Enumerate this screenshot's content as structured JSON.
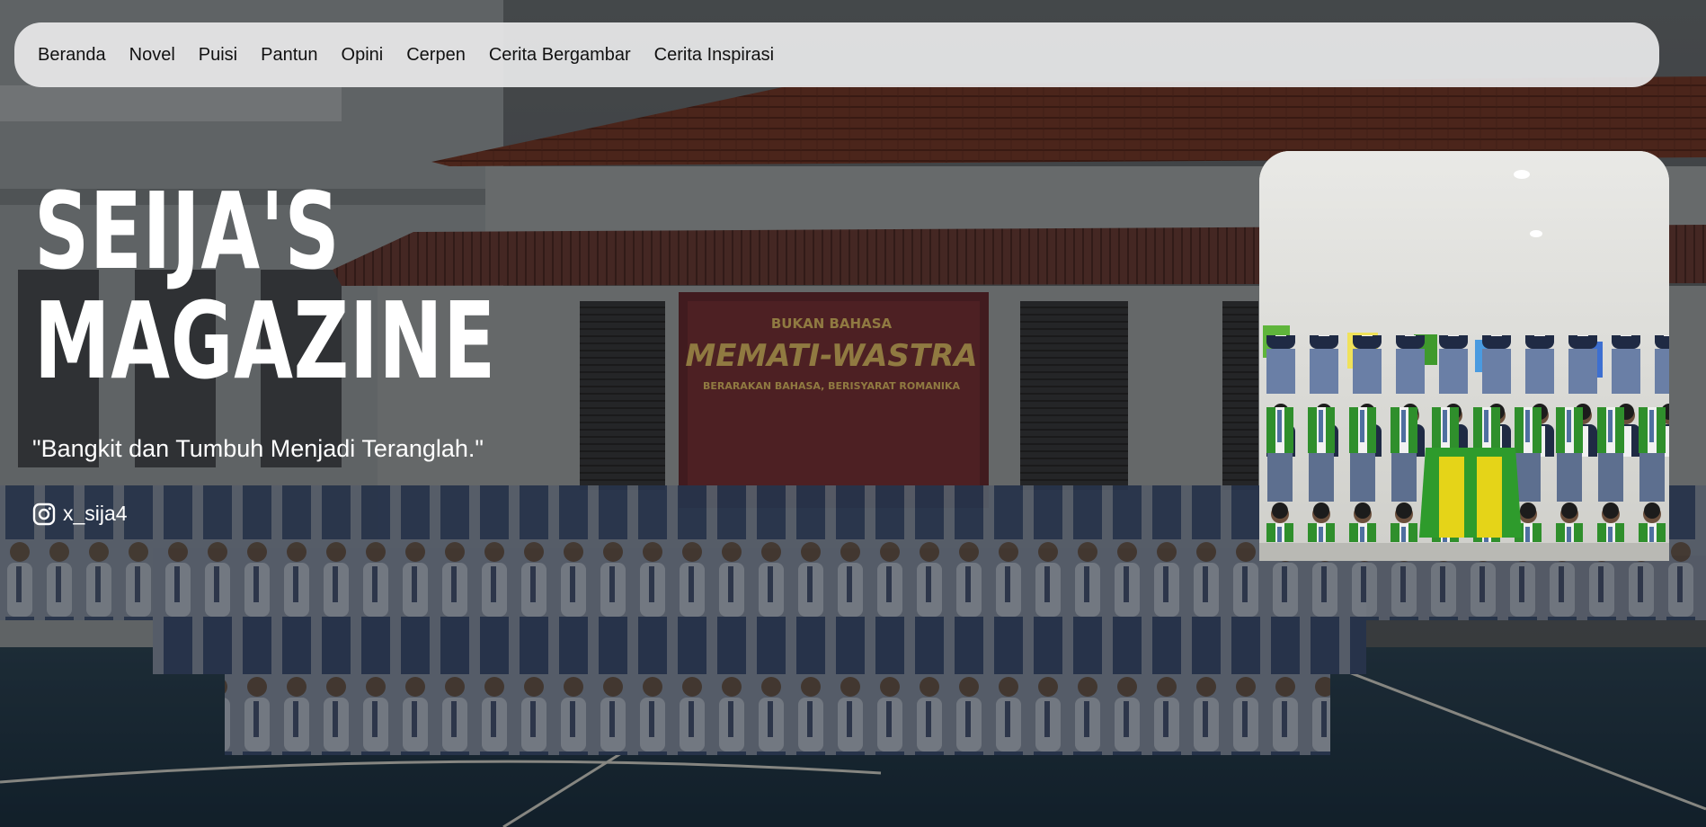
{
  "nav": {
    "items": [
      {
        "label": "Beranda"
      },
      {
        "label": "Novel"
      },
      {
        "label": "Puisi"
      },
      {
        "label": "Pantun"
      },
      {
        "label": "Opini"
      },
      {
        "label": "Cerpen"
      },
      {
        "label": "Cerita Bergambar"
      },
      {
        "label": "Cerita Inspirasi"
      }
    ]
  },
  "hero": {
    "title_line1": "SEIJA'S",
    "title_line2": "MAGAZINE",
    "tagline": "\"Bangkit dan Tumbuh Menjadi Teranglah.\"",
    "social": {
      "icon": "instagram-icon",
      "handle": "x_sija4"
    },
    "banner_text": {
      "top": "BUKAN BAHASA",
      "main": "MEMATI-WASTRA",
      "sub": "BERARAKAN BAHASA, BERISYARAT ROMANIKA"
    }
  },
  "colors": {
    "navbar_bg": "#e8e8ea",
    "text_light": "#ffffff",
    "text_dark": "#111111",
    "jacket_green": "#2e9b2c",
    "jacket_yellow": "#e5d418"
  }
}
